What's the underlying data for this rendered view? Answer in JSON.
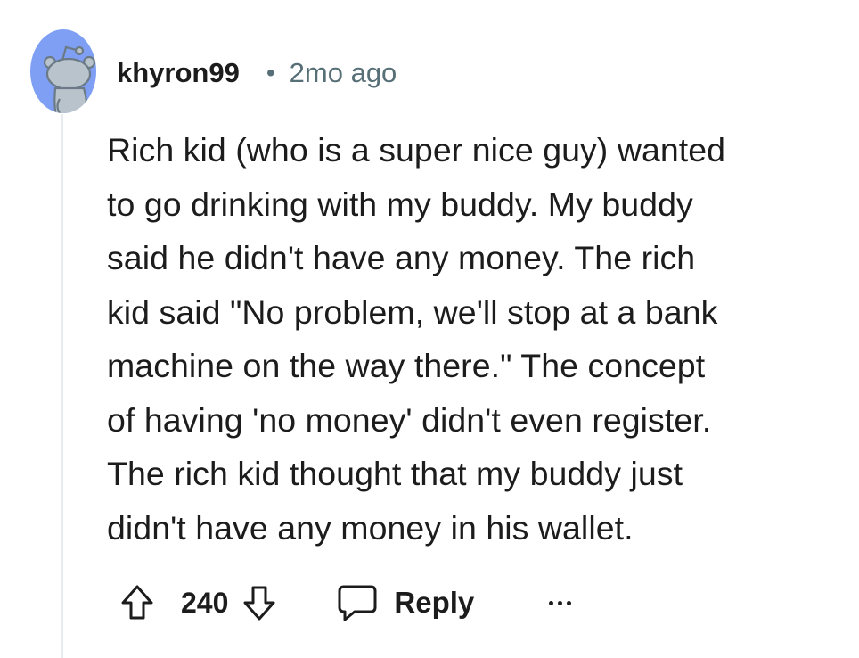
{
  "comment": {
    "username": "khyron99",
    "separator": "•",
    "timestamp": "2mo ago",
    "body": "Rich kid (who is a super nice guy) wanted\nto go drinking with my buddy. My buddy\nsaid he didn't have any money. The rich\nkid said \"No problem, we'll stop at a bank\nmachine on the way there.\" The concept\nof having 'no money' didn't even register.\nThe rich kid thought that my buddy just\ndidn't have any money in his wallet.",
    "score": "240",
    "reply_label": "Reply"
  },
  "icons": {
    "avatar": "reddit-snoo-avatar",
    "upvote": "arrow-up-icon",
    "downvote": "arrow-down-icon",
    "reply": "speech-bubble-icon",
    "more": "ellipsis-icon"
  },
  "colors": {
    "avatar_bg": "#7e9ff3",
    "text": "#1c1c1c",
    "meta": "#576f76",
    "thread_line": "#e5ebee"
  }
}
